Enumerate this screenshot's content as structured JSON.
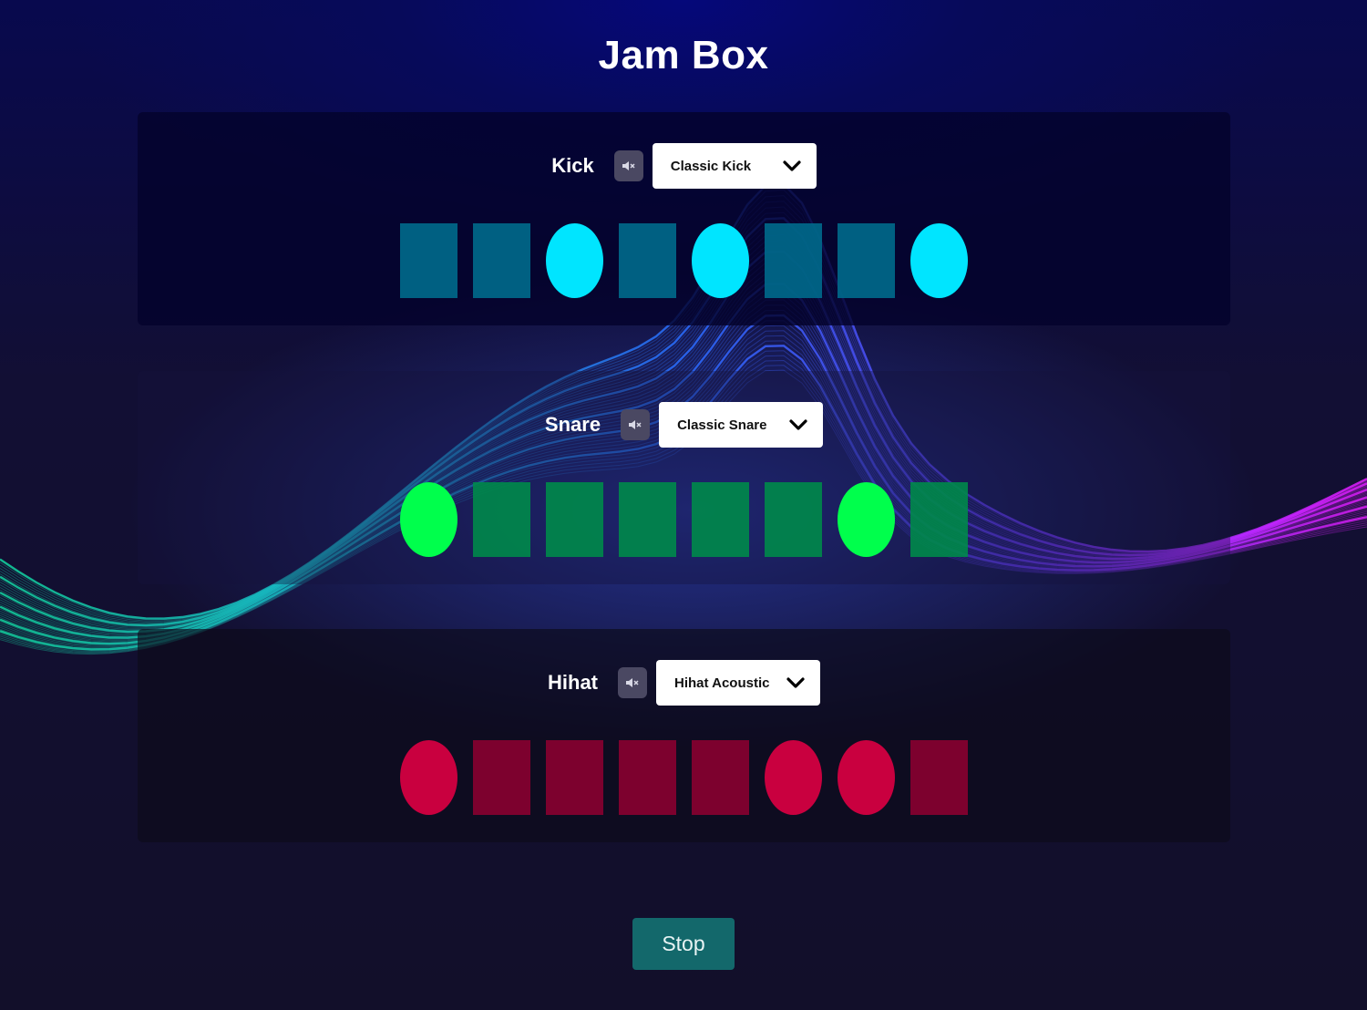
{
  "app": {
    "title": "Jam Box"
  },
  "colors": {
    "kick_on": "#00e5ff",
    "kick_off": "#006a8c",
    "snare_on": "#00ff4c",
    "snare_off": "#00894a",
    "hihat_on": "#c9003f",
    "hihat_off": "#8a0030",
    "stop_button": "#13686b"
  },
  "tracks": [
    {
      "id": "kick",
      "label": "Kick",
      "mute_icon": "speaker-icon",
      "selected_sound": "Classic Kick",
      "steps": [
        false,
        false,
        true,
        false,
        true,
        false,
        false,
        true
      ]
    },
    {
      "id": "snare",
      "label": "Snare",
      "mute_icon": "speaker-icon",
      "selected_sound": "Classic Snare",
      "steps": [
        true,
        false,
        false,
        false,
        false,
        false,
        true,
        false
      ]
    },
    {
      "id": "hihat",
      "label": "Hihat",
      "mute_icon": "speaker-icon",
      "selected_sound": "Hihat Acoustic",
      "steps": [
        true,
        false,
        false,
        false,
        false,
        true,
        true,
        false
      ]
    }
  ],
  "controls": {
    "stop_label": "Stop"
  }
}
